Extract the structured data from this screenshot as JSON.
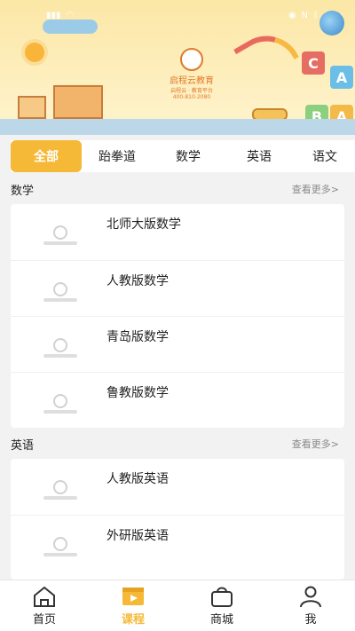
{
  "banner": {
    "logo_text": "启程云教育",
    "logo_sub": "启程云 · 教育平台",
    "phone": "400-810-2080",
    "blocks": [
      "C",
      "A",
      "B",
      "A"
    ]
  },
  "tabs": [
    {
      "label": "全部",
      "active": true
    },
    {
      "label": "跆拳道",
      "active": false
    },
    {
      "label": "数学",
      "active": false
    },
    {
      "label": "英语",
      "active": false
    },
    {
      "label": "语文",
      "active": false
    }
  ],
  "sections": [
    {
      "title": "数学",
      "more": "查看更多>",
      "items": [
        "北师大版数学",
        "人教版数学",
        "青岛版数学",
        "鲁教版数学"
      ]
    },
    {
      "title": "英语",
      "more": "查看更多>",
      "items": [
        "人教版英语",
        "外研版英语"
      ]
    }
  ],
  "nav": [
    {
      "label": "首页",
      "icon": "home-icon",
      "active": false
    },
    {
      "label": "课程",
      "icon": "video-icon",
      "active": true
    },
    {
      "label": "商城",
      "icon": "bag-icon",
      "active": false
    },
    {
      "label": "我",
      "icon": "user-icon",
      "active": false
    }
  ],
  "colors": {
    "accent": "#f5b937",
    "banner_bg": "#fde9a8"
  }
}
